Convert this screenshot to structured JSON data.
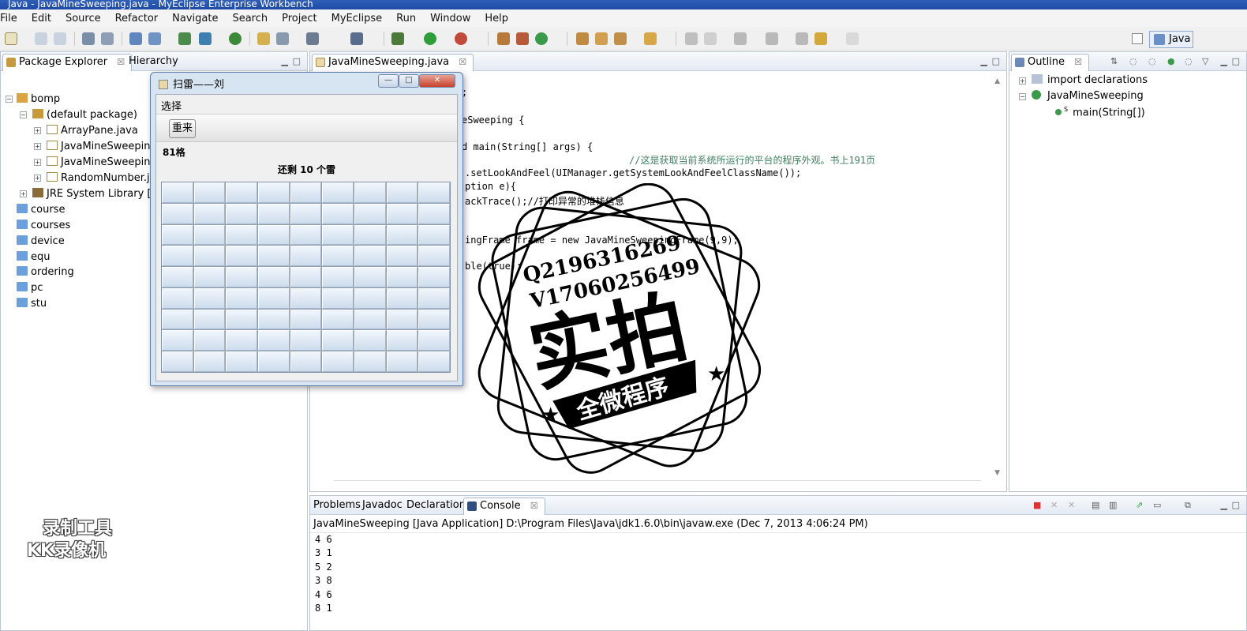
{
  "window": {
    "title": "Java - JavaMineSweeping.java - MyEclipse Enterprise Workbench"
  },
  "menubar": [
    "File",
    "Edit",
    "Source",
    "Refactor",
    "Navigate",
    "Search",
    "Project",
    "MyEclipse",
    "Run",
    "Window",
    "Help"
  ],
  "perspective": {
    "label": "Java"
  },
  "package_explorer": {
    "tabs": [
      {
        "label": "Package Explorer",
        "close": "☒"
      },
      {
        "label": "Hierarchy"
      }
    ],
    "items": [
      {
        "label": "bomp"
      },
      {
        "label": "(default package)"
      },
      {
        "label": "ArrayPane.java"
      },
      {
        "label": "JavaMineSweeping"
      },
      {
        "label": "JavaMineSweeping"
      },
      {
        "label": "RandomNumber.ja"
      },
      {
        "label": "JRE System Library [jdl"
      },
      {
        "label": "course"
      },
      {
        "label": "courses"
      },
      {
        "label": "device"
      },
      {
        "label": "equ"
      },
      {
        "label": "ordering"
      },
      {
        "label": "pc"
      },
      {
        "label": "stu"
      }
    ]
  },
  "editor": {
    "tab": {
      "label": "JavaMineSweeping.java",
      "close": "☒"
    },
    "lines": [
      {
        "text": ";"
      },
      {
        "text": "eSweeping {"
      },
      {
        "text": "d main(String[] args) {"
      },
      {
        "text": "//这是获取当前系统所运行的平台的程序外观。书上191页"
      },
      {
        "text": ".setLookAndFeel(UIManager.getSystemLookAndFeelClassName());"
      },
      {
        "text": "ption e){"
      },
      {
        "text": "ackTrace();//打印异常的堆栈信息"
      },
      {
        "text": "ingFrame frame = new JavaMineSweepingFrame(9,9);"
      },
      {
        "text": "ble(true);"
      }
    ]
  },
  "outline": {
    "tab": {
      "label": "Outline",
      "close": "☒"
    },
    "items": [
      {
        "label": "import declarations"
      },
      {
        "label": "JavaMineSweeping"
      },
      {
        "label": "main(String[])",
        "modifier": "S"
      }
    ]
  },
  "console": {
    "tabs": [
      {
        "label": "Problems"
      },
      {
        "label": "Javadoc"
      },
      {
        "label": "Declaration"
      },
      {
        "label": "Console",
        "close": "☒"
      }
    ],
    "header": "JavaMineSweeping [Java Application] D:\\Program Files\\Java\\jdk1.6.0\\bin\\javaw.exe (Dec 7, 2013 4:06:24 PM)",
    "lines": [
      "4  6",
      "3  1",
      "5  2",
      "3  8",
      "4  6",
      "8  1"
    ]
  },
  "minesweeper": {
    "title": "扫雷——刘",
    "menu": "选择",
    "restart_label": "重来",
    "cell_count": "81格",
    "status": "还剩  10  个雷",
    "rows": 9,
    "cols": 9,
    "controls": {
      "minimize": "—",
      "maximize": "□",
      "close": "✕"
    }
  },
  "watermarks": {
    "recorder": [
      "录制工具",
      "KK录像机"
    ],
    "stamp": {
      "line1": "Q2196316269",
      "line2": "V17060256499",
      "main": "实拍",
      "banner": "全微程序"
    }
  },
  "colors": {
    "titlebar": "#1d4aa5",
    "comment": "#3f7f5f",
    "keyword": "#7f0055"
  }
}
